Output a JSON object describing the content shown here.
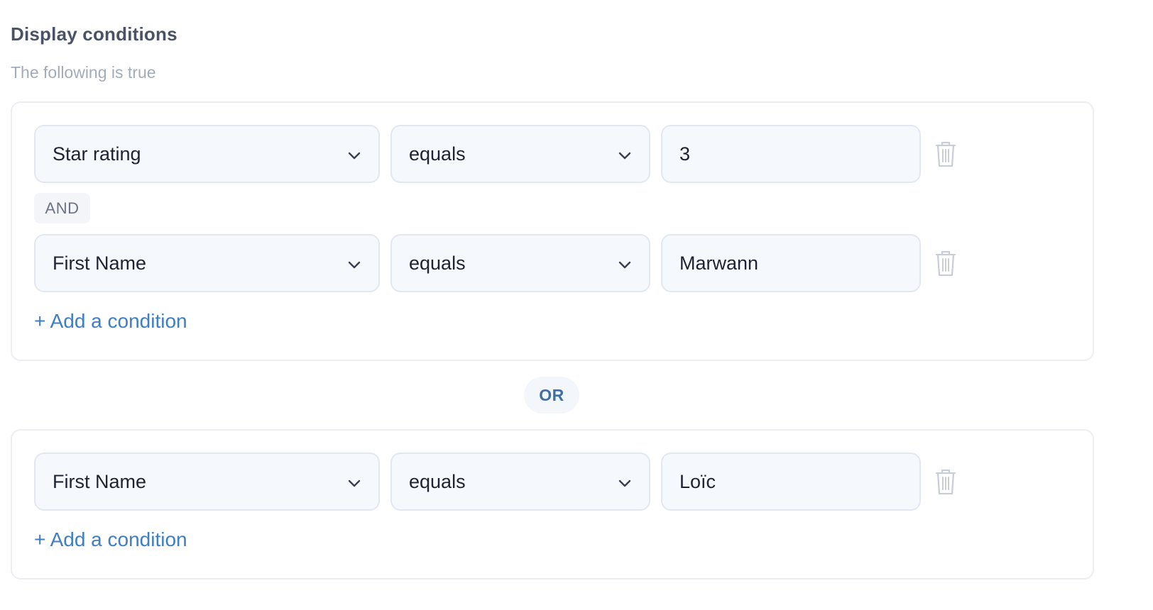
{
  "header": {
    "title": "Display conditions",
    "subtitle": "The following is true"
  },
  "groups": [
    {
      "conditions": [
        {
          "property": "Star rating",
          "operator": "equals",
          "value": "3"
        },
        {
          "property": "First Name",
          "operator": "equals",
          "value": "Marwann"
        }
      ],
      "joiner": "AND",
      "add_label": "+ Add a condition"
    },
    {
      "conditions": [
        {
          "property": "First Name",
          "operator": "equals",
          "value": "Loïc"
        }
      ],
      "add_label": "+ Add a condition"
    }
  ],
  "group_joiner": "OR",
  "icons": {
    "dropdown": "chevron-down-icon",
    "delete": "trash-icon"
  },
  "colors": {
    "link": "#3e7ec5",
    "or_badge_text": "#3e6fa8",
    "field_bg": "#f5f8fd"
  }
}
